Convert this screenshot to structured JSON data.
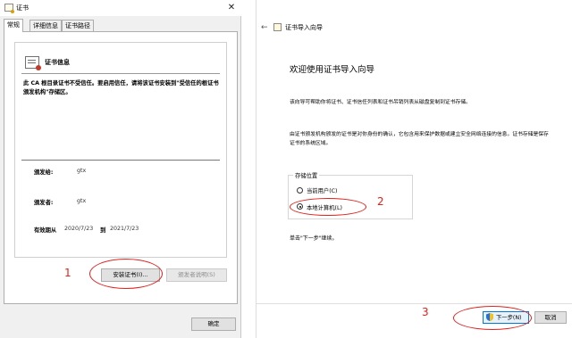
{
  "left_dialog": {
    "title": "证书",
    "close_glyph": "✕",
    "tabs": [
      {
        "label": "常规",
        "active": true
      },
      {
        "label": "详细信息",
        "active": false
      },
      {
        "label": "证书路径",
        "active": false
      }
    ],
    "info_title": "证书信息",
    "warning": "此 CA 根目录证书不受信任。要启用信任，请将该证书安装到\"受信任的根证书颁发机构\"存储区。",
    "fields": {
      "issued_to_label": "颁发给:",
      "issued_to": "gtx",
      "issued_by_label": "颁发者:",
      "issued_by": "gtx",
      "valid_label": "有效期从",
      "valid_from": "2020/7/23",
      "valid_to_word": "到",
      "valid_until": "2021/7/23"
    },
    "buttons": {
      "install": "安装证书(I)...",
      "issuer_statement": "颁发者说明(S)",
      "ok": "确定"
    }
  },
  "wizard": {
    "back_glyph": "←",
    "title": "证书导入向导",
    "heading": "欢迎使用证书导入向导",
    "para1": "该向导可帮助你将证书、证书信任列表和证书吊销列表从磁盘复制到证书存储。",
    "para2": "由证书颁发机构颁发的证书是对你身份的确认，它包含用来保护数据或建立安全网络连接的信息。证书存储是保存证书的系统区域。",
    "store_location_label": "存储位置",
    "options": [
      {
        "label": "当前用户(C)",
        "selected": false
      },
      {
        "label": "本地计算机(L)",
        "selected": true
      }
    ],
    "hint": "单击\"下一步\"继续。",
    "buttons": {
      "next": "下一步(N)",
      "cancel": "取消"
    }
  },
  "annotations": {
    "step1": "1",
    "step2": "2",
    "step3": "3",
    "color": "#e0201c"
  }
}
